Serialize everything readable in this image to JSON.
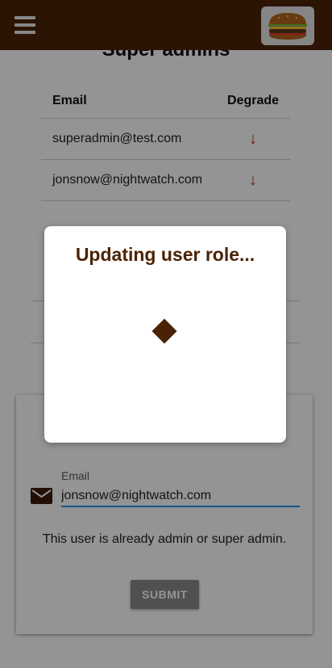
{
  "colors": {
    "topbar": "#4a2306",
    "accent": "#4a2306",
    "degrade_arrow": "#c62828",
    "input_underline": "#2196f3"
  },
  "header": {
    "menu_icon": "hamburger-menu-icon",
    "logo_icon": "burger-logo-icon"
  },
  "super_admins": {
    "title": "Super admins",
    "columns": {
      "email": "Email",
      "action": "Degrade"
    },
    "rows": [
      {
        "email": "superadmin@test.com",
        "action_icon": "arrow-down-icon",
        "action_glyph": "↓"
      },
      {
        "email": "jonsnow@nightwatch.com",
        "action_icon": "arrow-down-icon",
        "action_glyph": "↓"
      }
    ]
  },
  "admins": {
    "title": "",
    "columns": {
      "email": "",
      "action": ""
    },
    "rows": [
      {
        "email": ""
      }
    ]
  },
  "form": {
    "title": "",
    "email_label": "Email",
    "email_value": "jonsnow@nightwatch.com",
    "message": "This user is already admin or super admin.",
    "submit_label": "SUBMIT"
  },
  "modal": {
    "title": "Updating user role...",
    "spinner_icon": "diamond-spinner-icon"
  }
}
